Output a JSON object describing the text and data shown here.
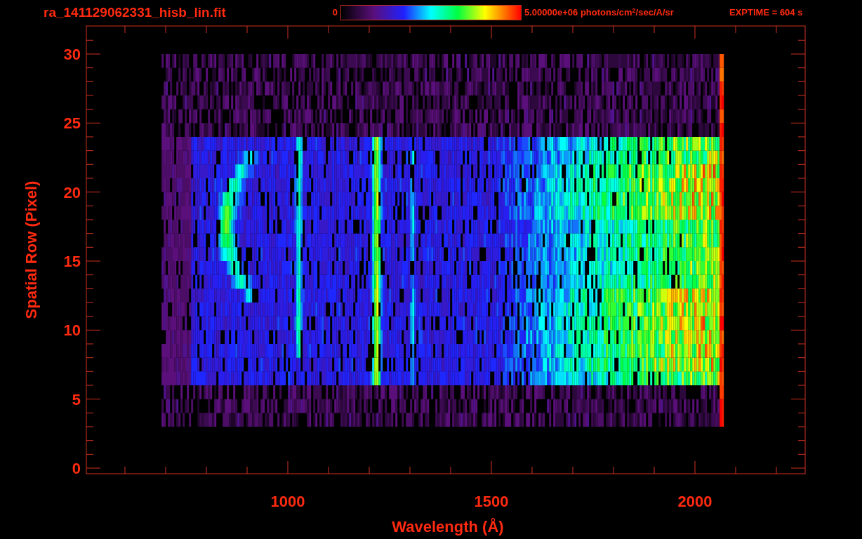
{
  "header": {
    "title": "ra_141129062331_hisb_lin.fit",
    "colorbar_min": "0",
    "colorbar_max": "5.00000e+06 photons/cm$^{2}$/sec/A/sr",
    "exptime": "EXPTIME = 604 s"
  },
  "plot": {
    "xlabel": "Wavelength (Å)",
    "ylabel": "Spatial Row (Pixel)",
    "xticks": [
      "1000",
      "1500",
      "2000"
    ],
    "yticks": [
      "30",
      "25",
      "20",
      "15",
      "10",
      "5",
      "0"
    ]
  }
}
